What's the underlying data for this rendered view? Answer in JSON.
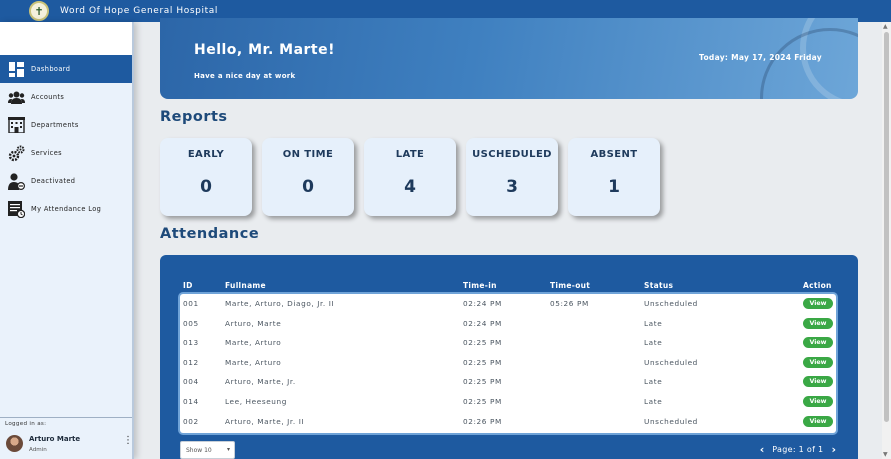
{
  "header": {
    "hospital_name": "Word Of Hope General Hospital",
    "logo_glyph": "✝"
  },
  "sidebar": {
    "items": [
      {
        "label": "Dashboard",
        "icon": "dashboard-grid-icon",
        "active": true
      },
      {
        "label": "Accounts",
        "icon": "users-group-icon",
        "active": false
      },
      {
        "label": "Departments",
        "icon": "building-icon",
        "active": false
      },
      {
        "label": "Services",
        "icon": "gears-icon",
        "active": false
      },
      {
        "label": "Deactivated",
        "icon": "user-deactivated-icon",
        "active": false
      },
      {
        "label": "My Attendance Log",
        "icon": "attendance-log-icon",
        "active": false
      }
    ],
    "logged_in_label": "Logged in as:",
    "user_name": "Arturo Marte",
    "user_role": "Admin",
    "menu_glyph": "⋮"
  },
  "banner": {
    "greeting": "Hello, Mr. Marte!",
    "subtitle": "Have a nice day at work",
    "today": "Today: May 17, 2024 Friday"
  },
  "reports": {
    "title": "Reports",
    "cards": [
      {
        "label": "EARLY",
        "value": "0"
      },
      {
        "label": "ON TIME",
        "value": "0"
      },
      {
        "label": "LATE",
        "value": "4"
      },
      {
        "label": "USCHEDULED",
        "value": "3"
      },
      {
        "label": "ABSENT",
        "value": "1"
      }
    ]
  },
  "attendance": {
    "title": "Attendance",
    "columns": {
      "id": "ID",
      "fullname": "Fullname",
      "time_in": "Time-in",
      "time_out": "Time-out",
      "status": "Status",
      "action": "Action"
    },
    "rows": [
      {
        "id": "001",
        "fullname": "Marte, Arturo, Diago, Jr. II",
        "time_in": "02:24 PM",
        "time_out": "05:26 PM",
        "status": "Unscheduled",
        "action": "View"
      },
      {
        "id": "005",
        "fullname": "Arturo, Marte",
        "time_in": "02:24 PM",
        "time_out": "",
        "status": "Late",
        "action": "View"
      },
      {
        "id": "013",
        "fullname": "Marte, Arturo",
        "time_in": "02:25 PM",
        "time_out": "",
        "status": "Late",
        "action": "View"
      },
      {
        "id": "012",
        "fullname": "Marte, Arturo",
        "time_in": "02:25 PM",
        "time_out": "",
        "status": "Unscheduled",
        "action": "View"
      },
      {
        "id": "004",
        "fullname": "Arturo, Marte, Jr.",
        "time_in": "02:25 PM",
        "time_out": "",
        "status": "Late",
        "action": "View"
      },
      {
        "id": "014",
        "fullname": "Lee, Heeseung",
        "time_in": "02:25 PM",
        "time_out": "",
        "status": "Late",
        "action": "View"
      },
      {
        "id": "002",
        "fullname": "Arturo, Marte, Jr. II",
        "time_in": "02:26 PM",
        "time_out": "",
        "status": "Unscheduled",
        "action": "View"
      }
    ],
    "show_select": "Show 10",
    "pagination": "Page: 1 of 1"
  },
  "colors": {
    "primary": "#1e5aa0",
    "view_button": "#3aa845",
    "heading": "#1e4a7a"
  }
}
